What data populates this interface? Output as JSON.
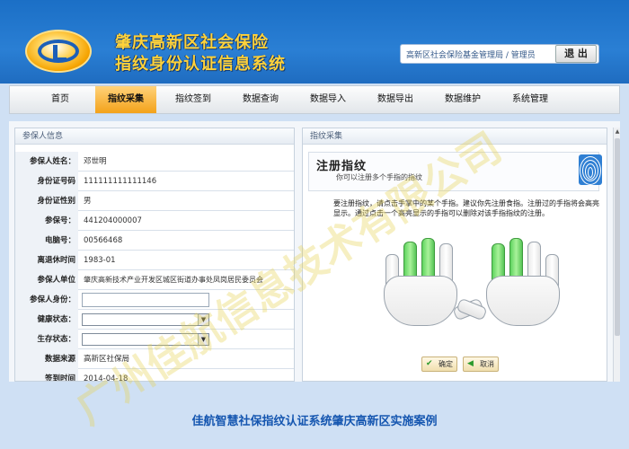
{
  "header": {
    "system_title_line1": "肇庆高新区社会保险",
    "system_title_line2": "指纹身份认证信息系统",
    "user_info": "高新区社会保险基金管理局 / 管理员",
    "logout_label": "退 出"
  },
  "nav": {
    "items": [
      {
        "label": "首页"
      },
      {
        "label": "指纹采集"
      },
      {
        "label": "指纹签到"
      },
      {
        "label": "数据查询"
      },
      {
        "label": "数据导入"
      },
      {
        "label": "数据导出"
      },
      {
        "label": "数据维护"
      },
      {
        "label": "系统管理"
      }
    ],
    "active_index": 1
  },
  "left_panel": {
    "title": "参保人信息",
    "fields": [
      {
        "label": "参保人姓名：",
        "value": "邓世明"
      },
      {
        "label": "身份证号码",
        "value": "111111111111146"
      },
      {
        "label": "身份证性别",
        "value": "男"
      },
      {
        "label": "参保号：",
        "value": "441204000007"
      },
      {
        "label": "电脑号：",
        "value": "00566468"
      },
      {
        "label": "离退休时间",
        "value": "1983-01"
      },
      {
        "label": "参保人单位",
        "value": "肇庆高新技术产业开发区城区街道办事处凤岗居民委员会"
      },
      {
        "label": "参保人身份：",
        "value": ""
      },
      {
        "label": "健康状态：",
        "value": ""
      },
      {
        "label": "生存状态：",
        "value": ""
      },
      {
        "label": "数据来源",
        "value": "高新区社保局"
      },
      {
        "label": "签到时间",
        "value": "2014-04-18"
      }
    ]
  },
  "right_panel": {
    "title": "指纹采集",
    "register_title": "注册指纹",
    "register_subtitle": "你可以注册多个手指的指纹",
    "instructions": "要注册指纹，请点击手掌中的某个手指。建议你先注册食指。注册过的手指将会高亮显示。通过点击一个高亮显示的手指可以删除对该手指指纹的注册。",
    "left_hand_fingers": [
      false,
      true,
      true,
      false
    ],
    "right_hand_fingers": [
      true,
      true,
      false,
      false
    ],
    "confirm_label": "确定",
    "cancel_label": "取消"
  },
  "footer": {
    "caption": "佳航智慧社保指纹认证系统肇庆高新区实施案例"
  },
  "watermark": {
    "text": "广州佳航信息技术有限公司"
  }
}
